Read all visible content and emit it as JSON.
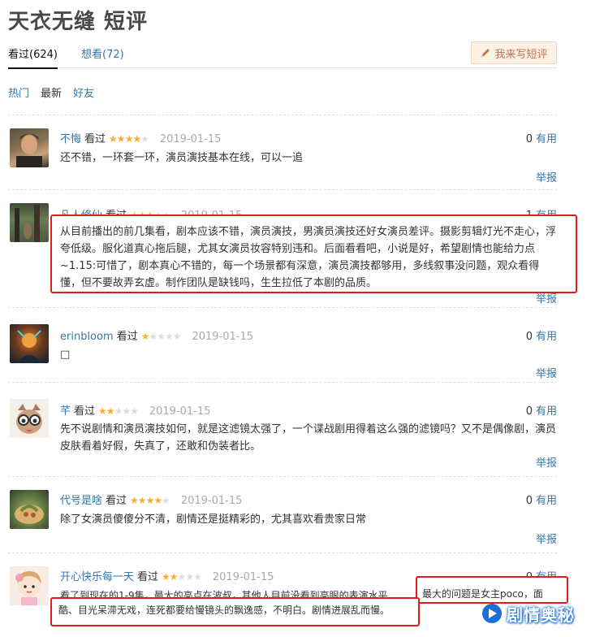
{
  "page": {
    "title": "天衣无缝 短评"
  },
  "tabs": [
    {
      "label": "看过(624)"
    },
    {
      "label": "想看(72)"
    }
  ],
  "write_button": {
    "label": "我来写短评",
    "icon": "pencil-icon"
  },
  "filters": {
    "hot": "热门",
    "newest": "最新",
    "friends": "好友"
  },
  "labels": {
    "seen": "看过",
    "useful": "有用",
    "report": "举报"
  },
  "comments": [
    {
      "user": "不悔",
      "stars": 4,
      "date": "2019-01-15",
      "votes": "0",
      "text": "还不错，一环套一环，演员演技基本在线，可以一追"
    },
    {
      "user": "凡人修仙",
      "stars": 3,
      "date": "2019-01-15",
      "votes": "1",
      "text": "从目前播出的前几集看，剧本应该不错，演员演技，男演员演技还好女演员差评。摄影剪辑灯光不走心，浮夸低级。服化道真心拖后腿，尤其女演员妆容特别违和。后面看看吧，小说是好，希望剧情也能给力点~1.15:可惜了，剧本真心不错的，每一个场景都有深意，演员演技都够用，多线叙事没问题，观众看得懂，但不要故弄玄虚。制作团队是缺钱吗，生生拉低了本剧的品质。"
    },
    {
      "user": "erinbloom",
      "stars": 1,
      "date": "2019-01-15",
      "votes": "0",
      "text": "□"
    },
    {
      "user": "芊",
      "stars": 2,
      "date": "2019-01-15",
      "votes": "0",
      "text": "先不说剧情和演员演技如何，就是这滤镜太强了，一个谍战剧用得着这么强的滤镜吗？又不是偶像剧，演员皮肤看着好假，失真了，还敢和伪装者比。"
    },
    {
      "user": "代号是啥",
      "stars": 4,
      "date": "2019-01-15",
      "votes": "0",
      "text": "除了女演员傻傻分不清，剧情还是挺精彩的，尤其喜欢看贵家日常"
    },
    {
      "user": "开心快乐每一天",
      "stars": 2,
      "date": "2019-01-15",
      "votes": "0",
      "text_line1a": "看了到现在的1-9集，最大的亮点在波叔，其他人目前没看到亮眼的表演水平",
      "text_line1b": "最大的问题是女主poco，面",
      "text_line2": "酷、目光呆滞无戏，连死都要给慢镜头的飘逸感，不明白。剧情进展乱而慢。"
    }
  ],
  "watermark": {
    "text": "剧情奥秘"
  },
  "colors": {
    "link": "#3377aa",
    "star": "#ffac2d",
    "highlight_box": "#e11c1c"
  }
}
